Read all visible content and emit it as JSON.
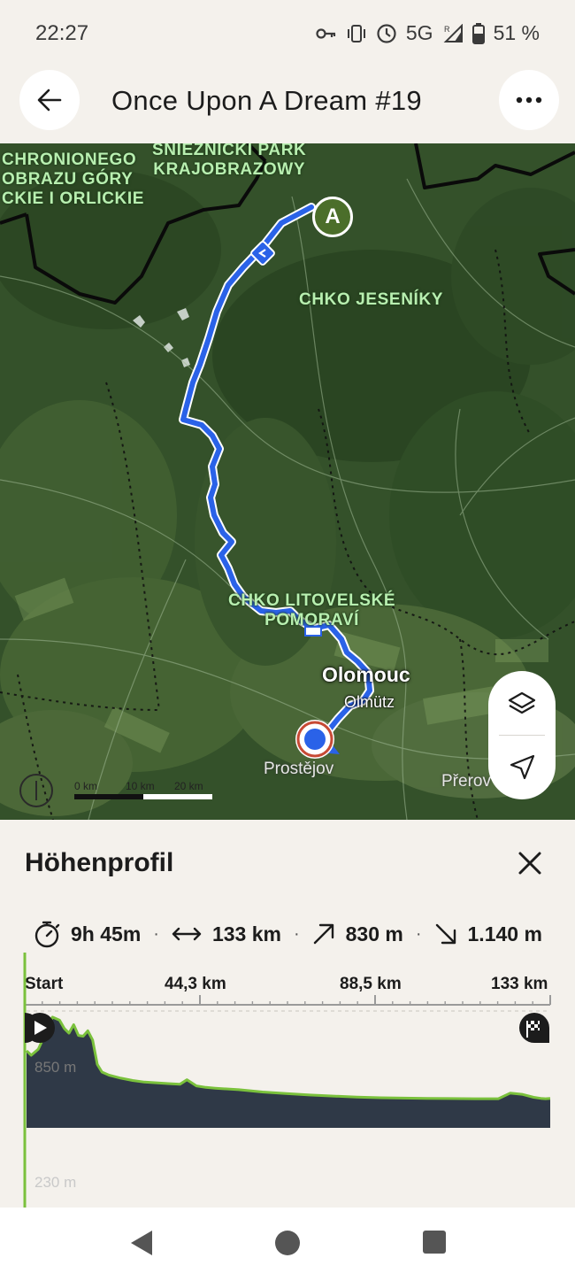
{
  "status_bar": {
    "time": "22:27",
    "network": "5G",
    "battery": "51 %",
    "icons": [
      "key-icon",
      "vibrate-icon",
      "alarm-icon",
      "signal-icon",
      "battery-icon"
    ]
  },
  "header": {
    "title": "Once Upon A Dream #19",
    "back_icon": "arrow-left-icon",
    "more_icon": "more-horizontal-icon"
  },
  "map": {
    "area_labels": [
      "CHRONIONEGO\nOBRAZU GÓRY\nCKIE I ORLICKIE",
      "SNIEZNICKI PARK\nKRAJOBRAZOWY",
      "CHKO JESENÍKY",
      "CHKO LITOVELSKÉ\nPOMORAVÍ"
    ],
    "city": "Olomouc",
    "city_alt": "Olmütz",
    "towns": [
      "Prostějov",
      "Přerov"
    ],
    "start_marker": "A",
    "scale": {
      "labels": [
        "0 km",
        "10 km",
        "20 km"
      ]
    },
    "controls": [
      "layers-icon",
      "navigation-arrow-icon"
    ]
  },
  "profile_sheet": {
    "title": "Höhenprofil",
    "close_icon": "close-icon",
    "stats": {
      "duration": "9h 45m",
      "distance": "133 km",
      "ascent": "830 m",
      "descent": "1.140 m"
    },
    "x_ticks": [
      "Start",
      "44,3 km",
      "88,5 km",
      "133 km"
    ],
    "elevation_max_label": "850 m",
    "elevation_min_label": "230 m",
    "start_icon": "play-icon",
    "finish_icon": "finish-flag-icon"
  },
  "chart_data": {
    "type": "area",
    "xlabel": "",
    "ylabel": "",
    "ylim": [
      180,
      880
    ],
    "x": [
      0,
      2,
      5,
      8,
      11,
      14,
      16,
      18,
      20,
      22,
      24,
      26,
      28,
      30,
      32,
      35,
      40,
      45,
      50,
      55,
      60,
      65,
      68,
      70,
      72,
      76,
      80,
      90,
      100,
      110,
      120,
      130,
      140,
      150,
      170,
      190,
      200,
      205,
      210,
      215,
      218,
      220,
      222
    ],
    "y": [
      590,
      560,
      600,
      700,
      810,
      790,
      735,
      705,
      760,
      690,
      685,
      720,
      660,
      500,
      450,
      430,
      410,
      395,
      385,
      380,
      375,
      370,
      400,
      380,
      360,
      350,
      345,
      335,
      320,
      310,
      300,
      293,
      287,
      282,
      278,
      276,
      276,
      312,
      305,
      285,
      278,
      276,
      278
    ]
  },
  "nav_bar": {
    "buttons": [
      "back-triangle-icon",
      "home-circle-icon",
      "recents-square-icon"
    ]
  },
  "colors": {
    "route": "#2a62e8",
    "profile_line": "#7ac13c",
    "profile_fill": "#2f3947",
    "background": "#f4f1ec"
  }
}
